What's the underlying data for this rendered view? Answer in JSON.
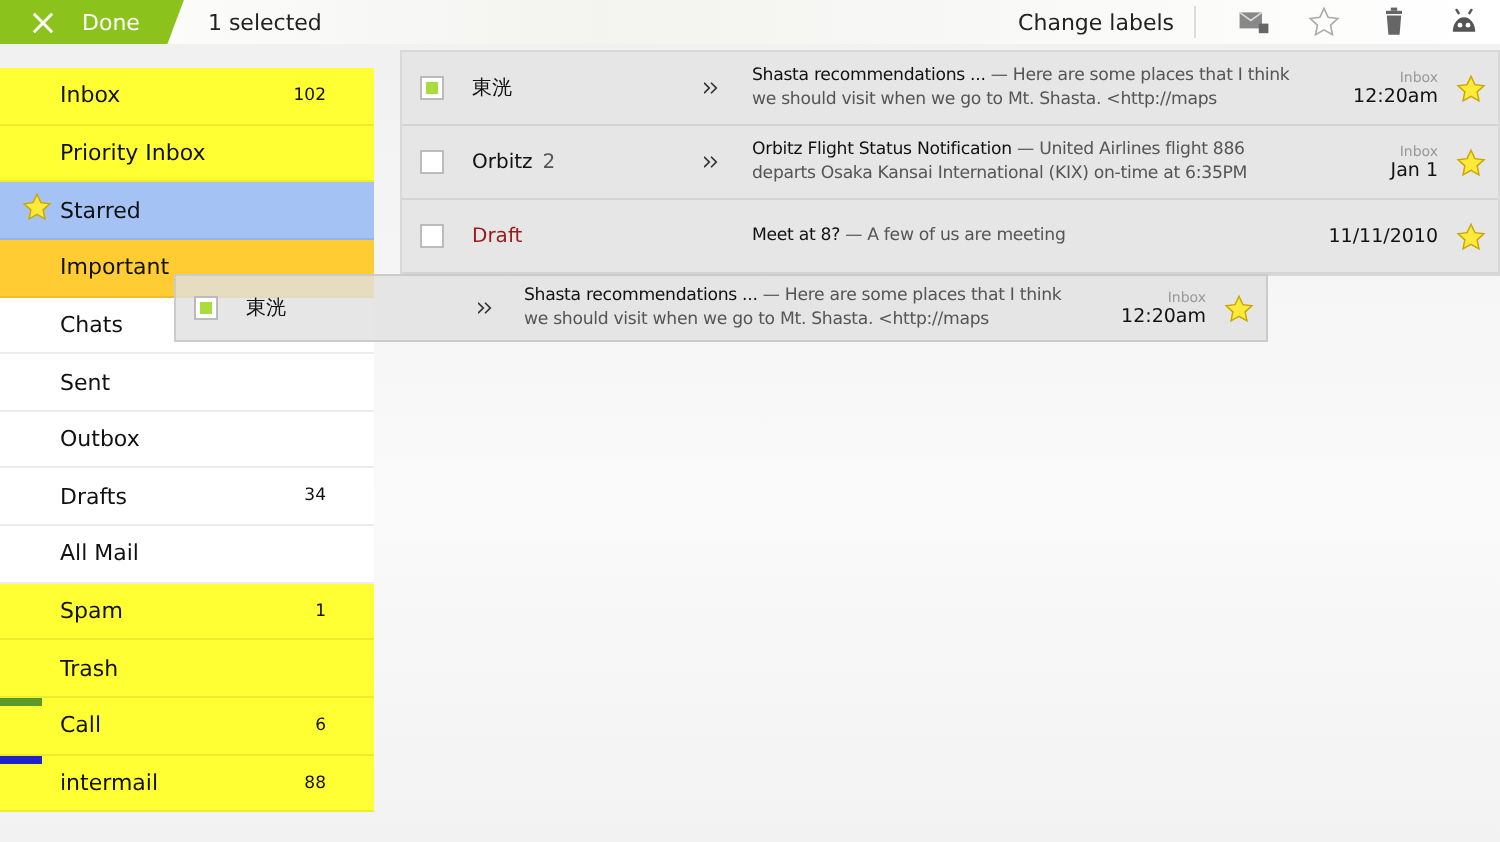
{
  "action_bar": {
    "done_label": "Done",
    "selection_count": "1 selected",
    "change_labels": "Change labels"
  },
  "sidebar": {
    "items": [
      {
        "label": "Inbox",
        "count": "102",
        "color": "#ffff33",
        "starred": false
      },
      {
        "label": "Priority Inbox",
        "color": "#ffff33",
        "starred": false
      },
      {
        "label": "Starred",
        "color": "#a4c2f4",
        "starred": true
      },
      {
        "label": "Important",
        "color": "#ffcc33",
        "starred": false
      },
      {
        "label": "Chats",
        "color": "#ffffff",
        "starred": false
      },
      {
        "label": "Sent",
        "color": "#ffffff",
        "starred": false
      },
      {
        "label": "Outbox",
        "color": "#ffffff",
        "starred": false
      },
      {
        "label": "Drafts",
        "count": "34",
        "color": "#ffffff",
        "starred": false
      },
      {
        "label": "All Mail",
        "color": "#ffffff",
        "starred": false
      },
      {
        "label": "Spam",
        "count": "1",
        "color": "#ffff33",
        "starred": false
      },
      {
        "label": "Trash",
        "color": "#ffff33",
        "starred": false
      },
      {
        "label": "Call",
        "count": "6",
        "color": "#ffff33",
        "tag": {
          "color": "#5a9a2a"
        },
        "starred": false
      },
      {
        "label": "intermail",
        "count": "88",
        "color": "#ffff33",
        "tag": {
          "color": "#2222cc"
        },
        "starred": false
      }
    ]
  },
  "messages": [
    {
      "sender": "東洸",
      "draft": false,
      "checked": true,
      "subject": "Shasta recommendations ...",
      "snippet": "— Here are some places that I think we should visit when we go to Mt. Shasta. <http://maps",
      "label": "Inbox",
      "date": "12:20am",
      "starred": true,
      "has_arrow": true
    },
    {
      "sender": "Orbitz",
      "sender_count": "2",
      "draft": false,
      "checked": false,
      "subject": "Orbitz Flight Status Notification",
      "snippet": "— United Airlines flight 886 departs Osaka Kansai International (KIX) on-time at 6:35PM",
      "label": "Inbox",
      "date": "Jan 1",
      "starred": true,
      "has_arrow": true
    },
    {
      "sender": "Draft",
      "draft": true,
      "checked": false,
      "subject": "Meet at 8?",
      "snippet": "— A few of us are meeting",
      "date": "11/11/2010",
      "starred": true,
      "has_arrow": false
    }
  ],
  "drag_ghost": {
    "sender": "東洸",
    "checked": true,
    "subject": "Shasta recommendations ...",
    "snippet": "— Here are some places that I think we should visit when we go to Mt. Shasta. <http://maps",
    "label": "Inbox",
    "date": "12:20am",
    "starred": true
  }
}
